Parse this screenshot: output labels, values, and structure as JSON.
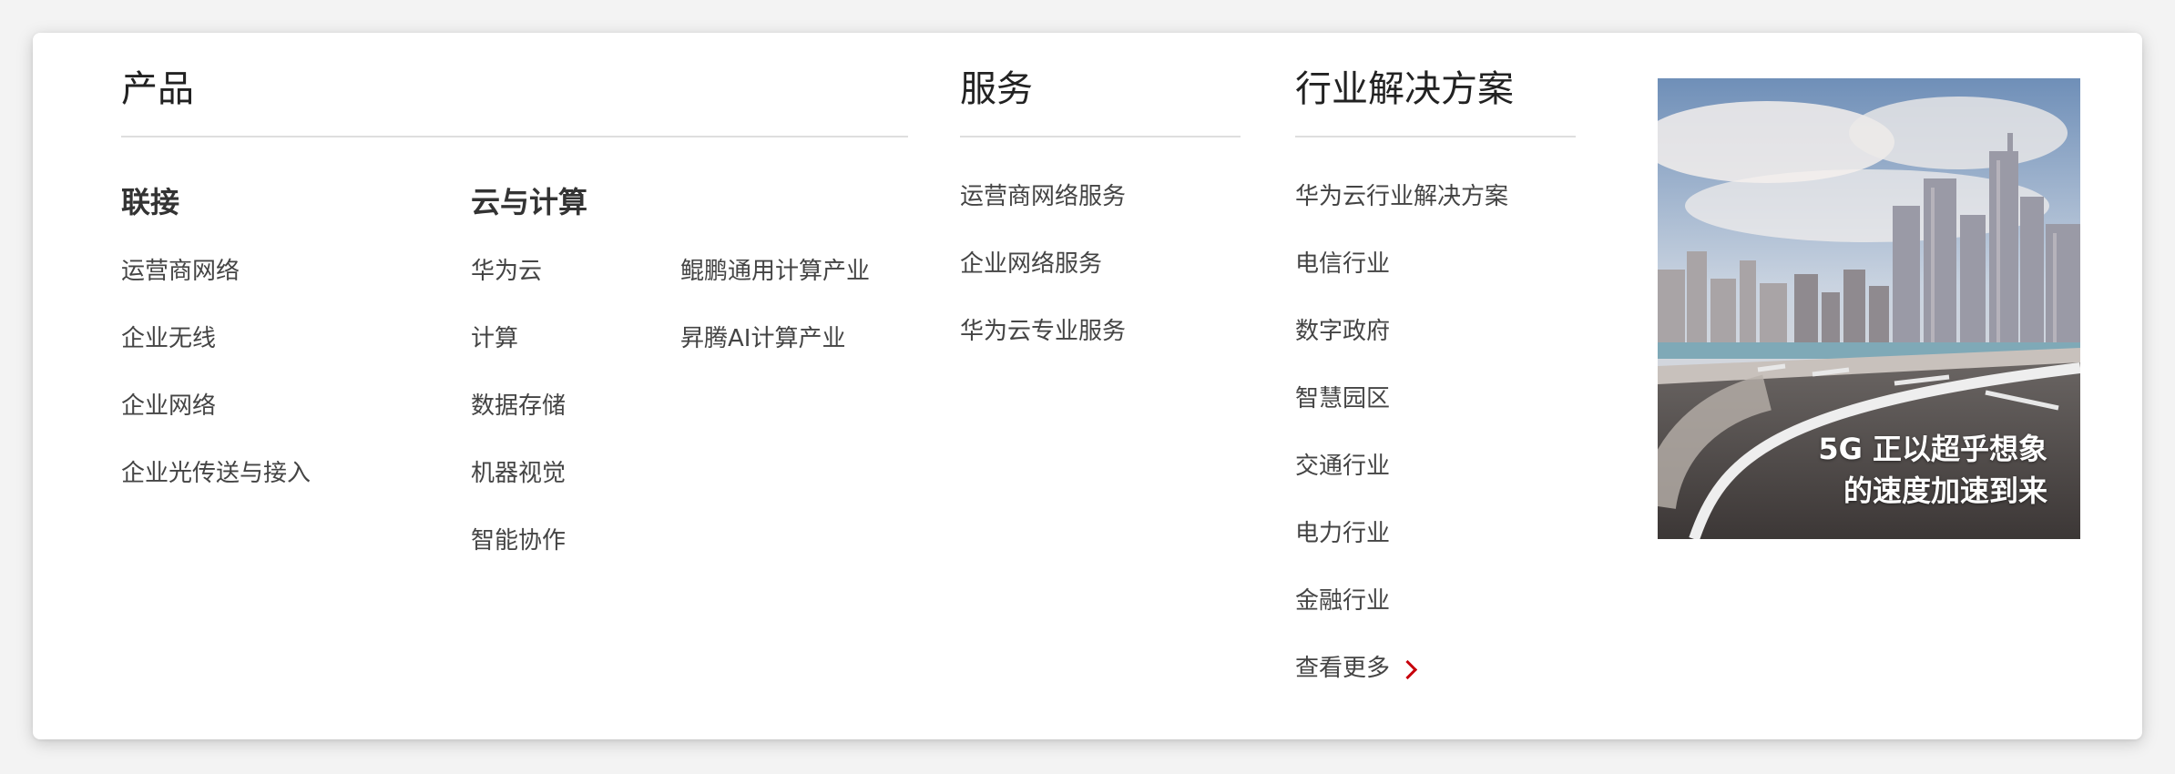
{
  "products": {
    "title": "产品",
    "connect": {
      "title": "联接",
      "items": [
        "运营商网络",
        "企业无线",
        "企业网络",
        "企业光传送与接入"
      ]
    },
    "cloud": {
      "title": "云与计算",
      "items_a": [
        "华为云",
        "计算",
        "数据存储",
        "机器视觉",
        "智能协作"
      ],
      "items_b": [
        "鲲鹏通用计算产业",
        "昇腾AI计算产业"
      ]
    }
  },
  "services": {
    "title": "服务",
    "items": [
      "运营商网络服务",
      "企业网络服务",
      "华为云专业服务"
    ]
  },
  "solutions": {
    "title": "行业解决方案",
    "items": [
      "华为云行业解决方案",
      "电信行业",
      "数字政府",
      "智慧园区",
      "交通行业",
      "电力行业",
      "金融行业"
    ],
    "more_label": "查看更多"
  },
  "promo": {
    "line1": "5G 正以超乎想象",
    "line2": "的速度加速到来"
  },
  "colors": {
    "accent": "#c7000b",
    "divider": "#dedede"
  }
}
